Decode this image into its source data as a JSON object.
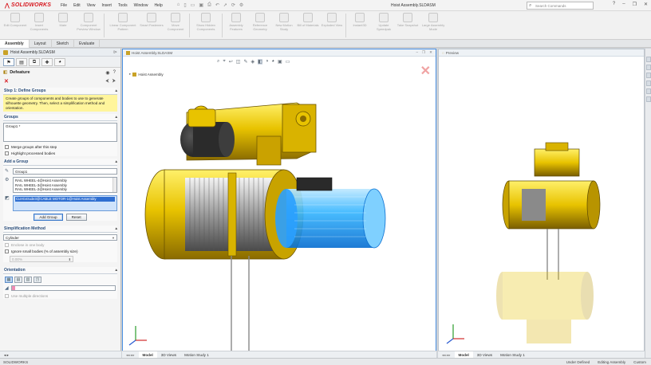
{
  "app": {
    "logo_text": "SOLIDWORKS",
    "document_title": "Hoist Assembly.SLDASM",
    "menus": [
      "File",
      "Edit",
      "View",
      "Insert",
      "Tools",
      "Window",
      "Help"
    ],
    "search_placeholder": "Search Commands"
  },
  "ribbon": {
    "groups": [
      [
        "Edit Component",
        "Insert Components",
        "Mate",
        "Component Preview Window"
      ],
      [
        "Linear Component Pattern",
        "Smart Fasteners",
        "Move Component"
      ],
      [
        "Show Hidden Components"
      ],
      [
        "Assembly Features",
        "Reference Geometry",
        "New Motion Study",
        "Bill of Materials",
        "Exploded View"
      ],
      [
        "Instant3D",
        "Update Speedpak",
        "Take Snapshot",
        "Large Assembly Mode"
      ]
    ]
  },
  "command_tabs": [
    "Assembly",
    "Layout",
    "Sketch",
    "Evaluate"
  ],
  "panel": {
    "doc_node": "Hoist Assembly.SLDASM",
    "feature_title": "Defeature",
    "step": {
      "title": "Step 1: Define Groups",
      "message": "Create groups of components and bodies to use to generate silhouette geometry. Then, select a simplification method and orientation."
    },
    "groups": {
      "title": "Groups",
      "list": [
        "Group1 *"
      ],
      "merge_label": "Merge groups after this step",
      "highlight_label": "Highlight processed bodies"
    },
    "add_group": {
      "title": "Add a Group",
      "name_value": "Group1",
      "components": [
        "RAIL WHEEL-4@Hoist Assembly",
        "RAIL WHEEL-3@Hoist Assembly",
        "RAIL WHEEL-2@Hoist Assembly"
      ],
      "bodies": [
        "Cut-Extrude3@CABLE MOTOR-1@Hoist Assembly"
      ],
      "add_button": "Add Group",
      "reset_button": "Reset"
    },
    "simplification": {
      "title": "Simplification Method",
      "method": "Cylinder",
      "enclose_label": "Enclose in one body",
      "ignore_label": "Ignore small bodies (% of assembly size)",
      "percent_value": "0.00%"
    },
    "orientation": {
      "title": "Orientation",
      "multiple_label": "Use multiple directions"
    }
  },
  "viewport": {
    "tree_label": "Hoist Assembly"
  },
  "preview": {
    "title": "Preview"
  },
  "bottom_tabs": [
    "Model",
    "3D Views",
    "Motion Study 1"
  ],
  "status": {
    "left": "SOLIDWORKS",
    "items": [
      "Under Defined",
      "Editing Assembly",
      "Custom"
    ]
  },
  "colors": {
    "accent_red": "#d71920",
    "hoist_yellow": "#e8c300",
    "motor_glow": "#38b6ff",
    "hint_yellow": "#fff59c"
  }
}
